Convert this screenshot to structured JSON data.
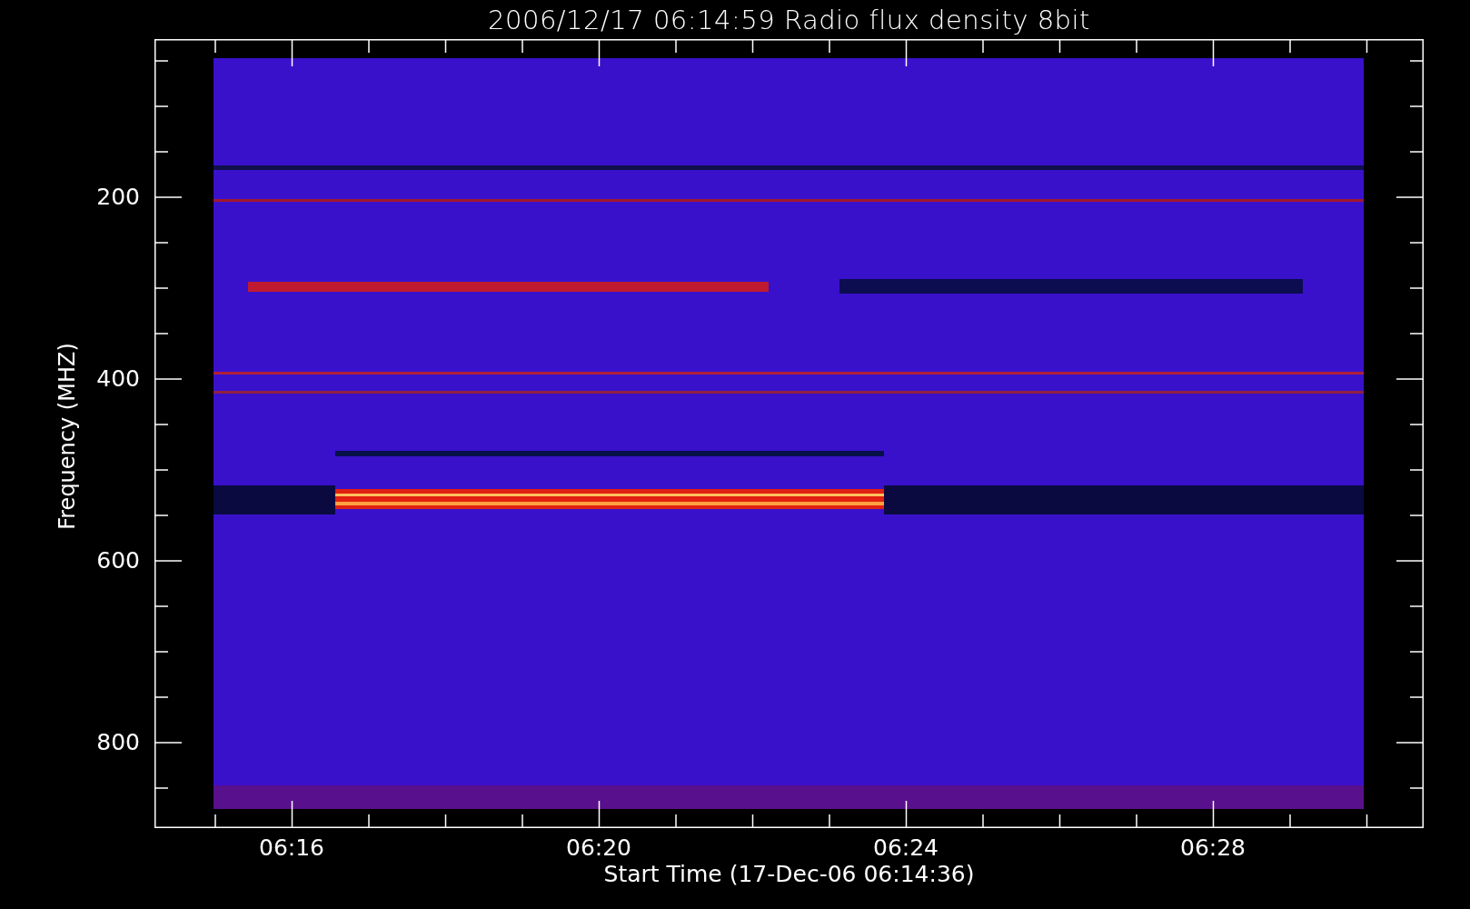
{
  "title": "2006/12/17 06:14:59 Radio flux density 8bit",
  "y_axis": {
    "label": "Frequency (MHZ)",
    "tick_labels": [
      "200",
      "400",
      "600",
      "800"
    ]
  },
  "x_axis": {
    "label": "Start Time (17-Dec-06 06:14:36)",
    "tick_labels": [
      "06:16",
      "06:20",
      "06:24",
      "06:28"
    ]
  }
}
